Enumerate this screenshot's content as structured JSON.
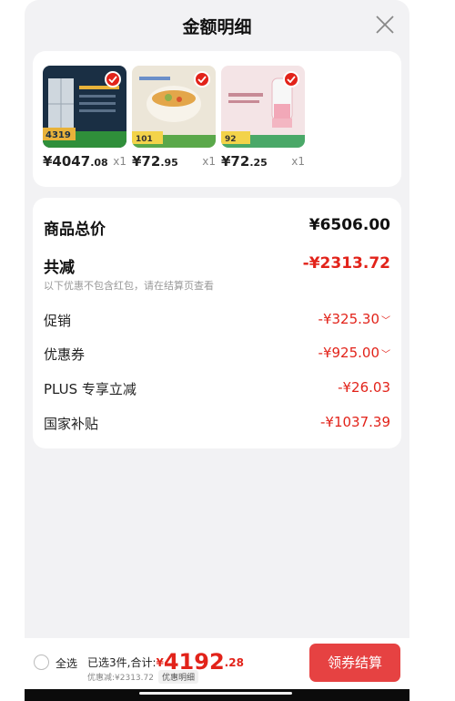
{
  "header": {
    "title": "金额明细"
  },
  "products": [
    {
      "name": "refrigerator",
      "price_main": "¥4047",
      "price_dec": ".08",
      "qty": "x1",
      "thumb_colors": [
        "#1a2f44",
        "#7f8f9c"
      ],
      "promo": "4319"
    },
    {
      "name": "electric-hot-pot",
      "price_main": "¥72",
      "price_dec": ".95",
      "qty": "x1",
      "thumb_colors": [
        "#e8e2d3",
        "#cdbb9a"
      ],
      "promo": "101"
    },
    {
      "name": "blender",
      "price_main": "¥72",
      "price_dec": ".25",
      "qty": "x1",
      "thumb_colors": [
        "#f2e0e0",
        "#d9b3ba"
      ],
      "promo": "92"
    }
  ],
  "summary": {
    "total_label": "商品总价",
    "total_value": "¥6506.00",
    "discount_label": "共减",
    "discount_value": "-¥2313.72",
    "note": "以下优惠不包含红包，请在结算页查看",
    "items": [
      {
        "label": "促销",
        "value": "-¥325.30",
        "expandable": true
      },
      {
        "label": "优惠券",
        "value": "-¥925.00",
        "expandable": true
      },
      {
        "label": "PLUS 专享立减",
        "value": "-¥26.03",
        "expandable": false
      },
      {
        "label": "国家补贴",
        "value": "-¥1037.39",
        "expandable": false
      }
    ]
  },
  "footer": {
    "select_all": "全选",
    "selected_text": "已选3件,合计:",
    "currency": "¥",
    "amount_main": "4192",
    "amount_dec": ".28",
    "discount_text": "优惠减:¥2313.72",
    "detail_chip": "优惠明细",
    "checkout_label": "领券结算"
  },
  "colors": {
    "accent": "#e2231a",
    "button": "#e64242",
    "background": "#f2f2f4"
  }
}
